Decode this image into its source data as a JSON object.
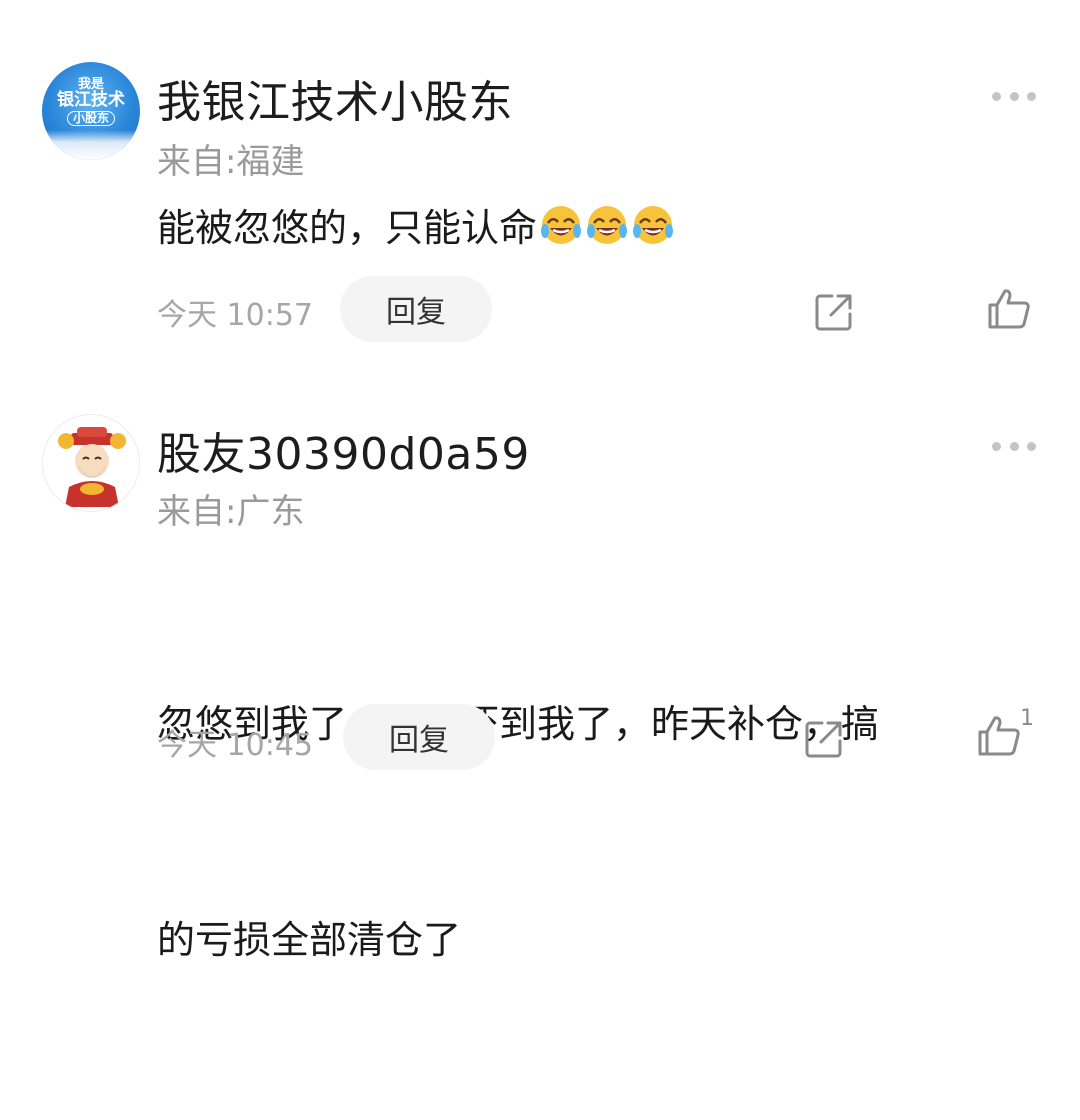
{
  "comments": [
    {
      "avatar_text": [
        "我是",
        "银江技术",
        "小股东"
      ],
      "username": "我银江技术小股东",
      "location": "来自:福建",
      "body": "能被忽悠的，只能认命",
      "emojis": [
        "rolling-laugh-emoji",
        "rolling-laugh-emoji",
        "rolling-laugh-emoji"
      ],
      "time": "今天 10:57",
      "reply_label": "回复",
      "like_count": ""
    },
    {
      "username": "股友30390d0a59",
      "location": "来自:广东",
      "body_line1": "忽悠到我了，早上吓到我了，昨天补仓，搞",
      "body_line2": "的亏损全部清仓了",
      "time": "今天 10:45",
      "reply_label": "回复",
      "like_count": "1"
    }
  ],
  "icons": {
    "more": "more-dots-icon",
    "share": "share-icon",
    "like": "thumb-up-icon"
  }
}
